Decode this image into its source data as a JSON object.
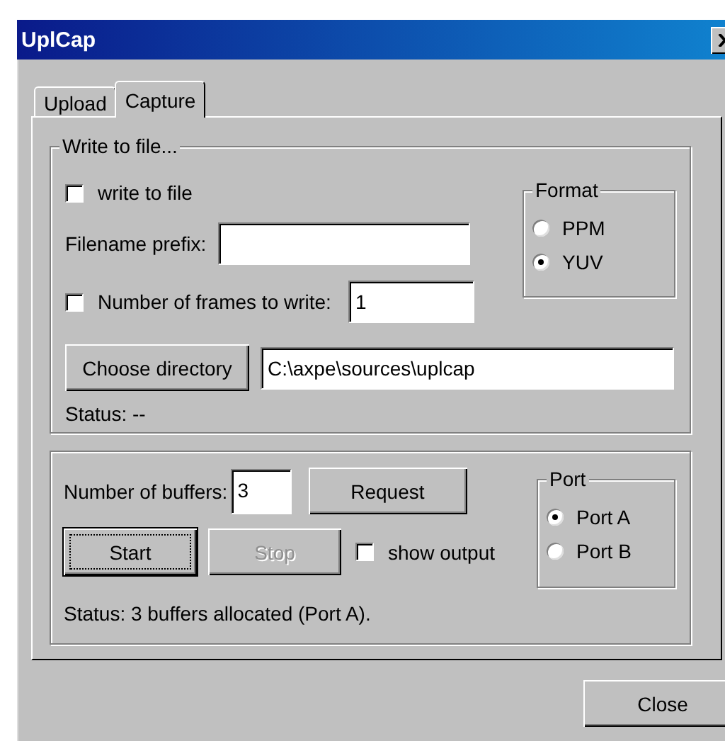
{
  "window": {
    "title": "UplCap"
  },
  "tabs": [
    {
      "label": "Upload",
      "selected": false
    },
    {
      "label": "Capture",
      "selected": true
    }
  ],
  "write_group": {
    "title": "Write to file...",
    "write_checkbox": {
      "label": "write to file",
      "checked": false
    },
    "prefix": {
      "label": "Filename prefix:"
    },
    "frames": {
      "label": "Number of frames to write:",
      "checked": false,
      "value": "1"
    },
    "format": {
      "title": "Format",
      "options": [
        {
          "label": "PPM",
          "selected": false
        },
        {
          "label": "YUV",
          "selected": true
        }
      ]
    },
    "choose_button": {
      "label": "Choose directory",
      "disabled": false,
      "default": false
    },
    "directory": {
      "value": "C:\\axpe\\sources\\uplcap"
    },
    "status": "Status: --"
  },
  "capture_group": {
    "buffers": {
      "label": "Number of buffers:",
      "value": "3"
    },
    "request_button": {
      "label": "Request",
      "disabled": false,
      "default": false
    },
    "start_button": {
      "label": "Start",
      "disabled": false,
      "default": true
    },
    "stop_button": {
      "label": "Stop",
      "disabled": true,
      "default": false
    },
    "show_output": {
      "label": "show output",
      "checked": false
    },
    "port": {
      "title": "Port",
      "options": [
        {
          "label": "Port A",
          "selected": true
        },
        {
          "label": "Port B",
          "selected": false
        }
      ]
    },
    "status": "Status: 3 buffers allocated (Port A)."
  },
  "close_button": {
    "label": "Close",
    "disabled": false,
    "default": false
  }
}
